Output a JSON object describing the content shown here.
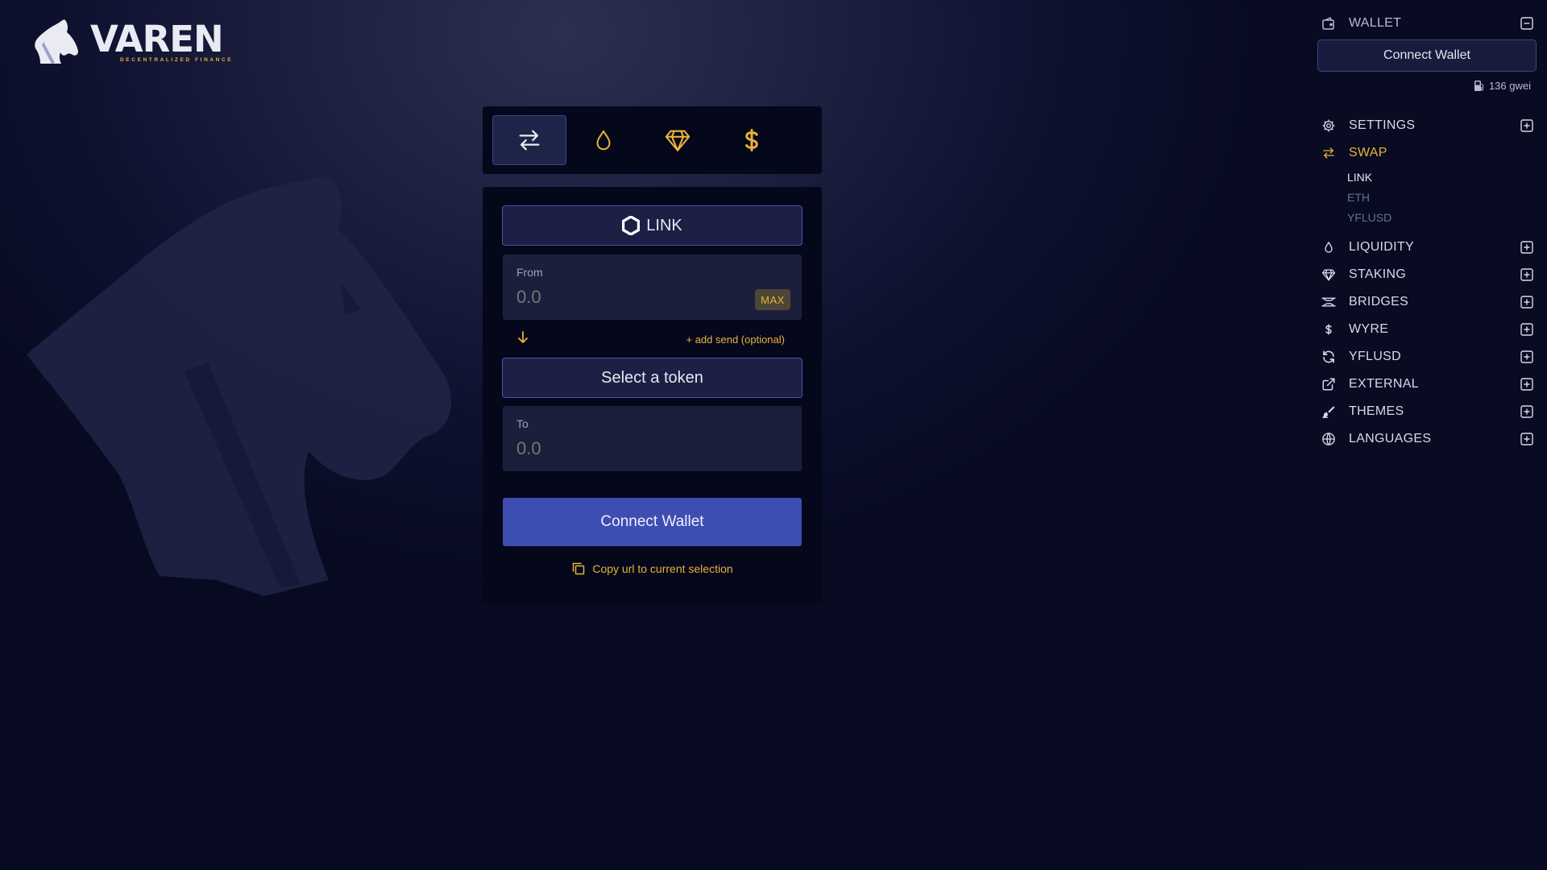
{
  "brand": {
    "name": "VAREN",
    "tagline": "DECENTRALIZED FINANCE"
  },
  "tabs": [
    {
      "icon": "swap-arrows-icon",
      "active": true
    },
    {
      "icon": "droplet-icon",
      "active": false
    },
    {
      "icon": "diamond-icon",
      "active": false
    },
    {
      "icon": "dollar-icon",
      "active": false
    }
  ],
  "swap": {
    "from_token": "LINK",
    "from_label": "From",
    "from_placeholder": "0.0",
    "max_label": "MAX",
    "add_send": "+ add send (optional)",
    "to_token_button": "Select a token",
    "to_label": "To",
    "to_placeholder": "0.0",
    "connect_button": "Connect Wallet",
    "copy_url": "Copy url to current selection"
  },
  "sidebar": {
    "wallet_label": "WALLET",
    "connect_button": "Connect Wallet",
    "gas": "136 gwei",
    "items": [
      {
        "label": "SETTINGS",
        "icon": "gear-icon"
      },
      {
        "label": "SWAP",
        "icon": "swap-arrows-icon",
        "active": true,
        "sub": [
          "LINK",
          "ETH",
          "YFLUSD"
        ]
      },
      {
        "label": "LIQUIDITY",
        "icon": "droplet-icon"
      },
      {
        "label": "STAKING",
        "icon": "diamond-icon"
      },
      {
        "label": "BRIDGES",
        "icon": "bridge-icon"
      },
      {
        "label": "WYRE",
        "icon": "dollar-icon"
      },
      {
        "label": "YFLUSD",
        "icon": "refresh-icon"
      },
      {
        "label": "EXTERNAL",
        "icon": "external-link-icon"
      },
      {
        "label": "THEMES",
        "icon": "brush-icon"
      },
      {
        "label": "LANGUAGES",
        "icon": "globe-icon"
      }
    ]
  },
  "colors": {
    "accent": "#e8b33a",
    "primary_button": "#3d4db2",
    "card_bg": "#05071a",
    "field_bg": "#1b1f3c"
  }
}
